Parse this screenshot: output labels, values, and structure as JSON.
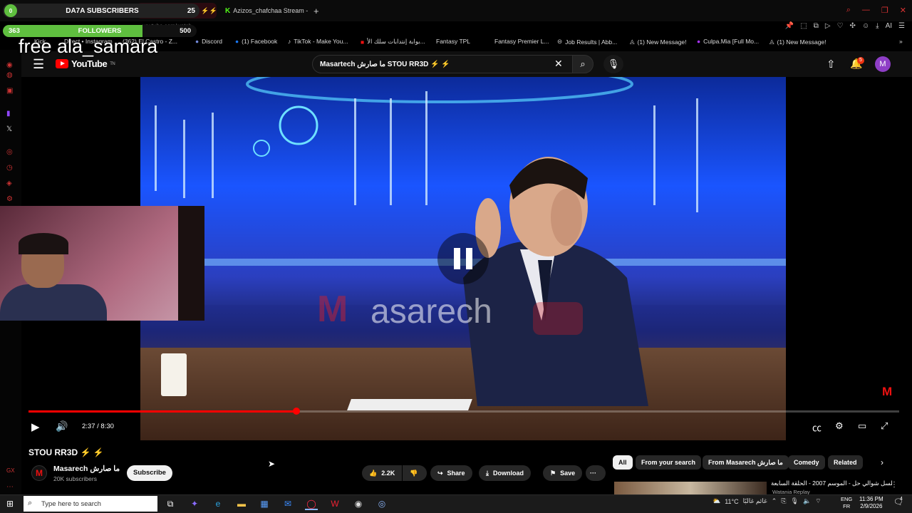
{
  "stream_overlay": {
    "subs_dot": "0",
    "subs_label": "DA7A SUBSCRIBERS",
    "subs_max": "25",
    "followers_current": "363",
    "followers_label": "FOLLOWERS",
    "followers_goal": "500",
    "followers_progress_pct": 72,
    "banner_text": "free ala_samara"
  },
  "tabs": [
    {
      "label": "(5) STOU RR3D ⚡⚡",
      "active": true
    },
    {
      "label": "Azizos_chafchaa Stream -",
      "active": false
    }
  ],
  "address": {
    "url": "youtube.com/watch"
  },
  "bookmarks": [
    {
      "label": "Kick"
    },
    {
      "label": "Direct • Instagram"
    },
    {
      "label": "(362) El Castro - Z..."
    },
    {
      "label": "Discord"
    },
    {
      "label": "(1) Facebook"
    },
    {
      "label": "TikTok - Make You..."
    },
    {
      "label": "بوابة إنتدابات سلك الأ..."
    },
    {
      "label": "Fantasy TPL"
    },
    {
      "label": "Fantasy Premier L..."
    },
    {
      "label": "Job Results | Abb..."
    },
    {
      "label": "(1) New Message!"
    },
    {
      "label": "Culpa.Mia [Full Mo..."
    },
    {
      "label": "(1) New Message!"
    }
  ],
  "youtube": {
    "logo_text": "YouTube",
    "logo_region": "TN",
    "search_value": "Masartech ما صارش STOU RR3D ⚡ ⚡",
    "notification_count": "5",
    "avatar_letter": "M"
  },
  "player": {
    "watermark": "asarech",
    "watermark_m": "M",
    "time": "2:37 / 8:30",
    "progress_fraction": 0.308
  },
  "video_info": {
    "title": "STOU RR3D ⚡ ⚡",
    "channel_name": "Masarech ما صارش",
    "channel_logo": "M",
    "subscribers": "20K subscribers",
    "subscribe_label": "Subscribe",
    "likes": "2.2K",
    "share_label": "Share",
    "download_label": "Download",
    "save_label": "Save",
    "more_label": "···"
  },
  "chips": [
    "All",
    "From your search",
    "From Masarech ما صارش",
    "Comedy",
    "Related"
  ],
  "recommendation": {
    "title": "مسلسل شوالي حل - الموسم 2007 - الحلقة السابعة",
    "channel": "Watania Replay"
  },
  "taskbar": {
    "search_placeholder": "Type here to search",
    "weather": "11°C",
    "weather_desc": "غائم غالبًا",
    "lang_top": "ENG",
    "lang_bottom": "FR",
    "time": "11:36 PM",
    "date": "2/9/2026",
    "notif_count": "4"
  },
  "colors": {
    "yt_red": "#ff0000",
    "overlay_green": "#5fbf3f",
    "yt_dark": "#0f0f0f",
    "avatar_purple": "#8e3ec6"
  }
}
